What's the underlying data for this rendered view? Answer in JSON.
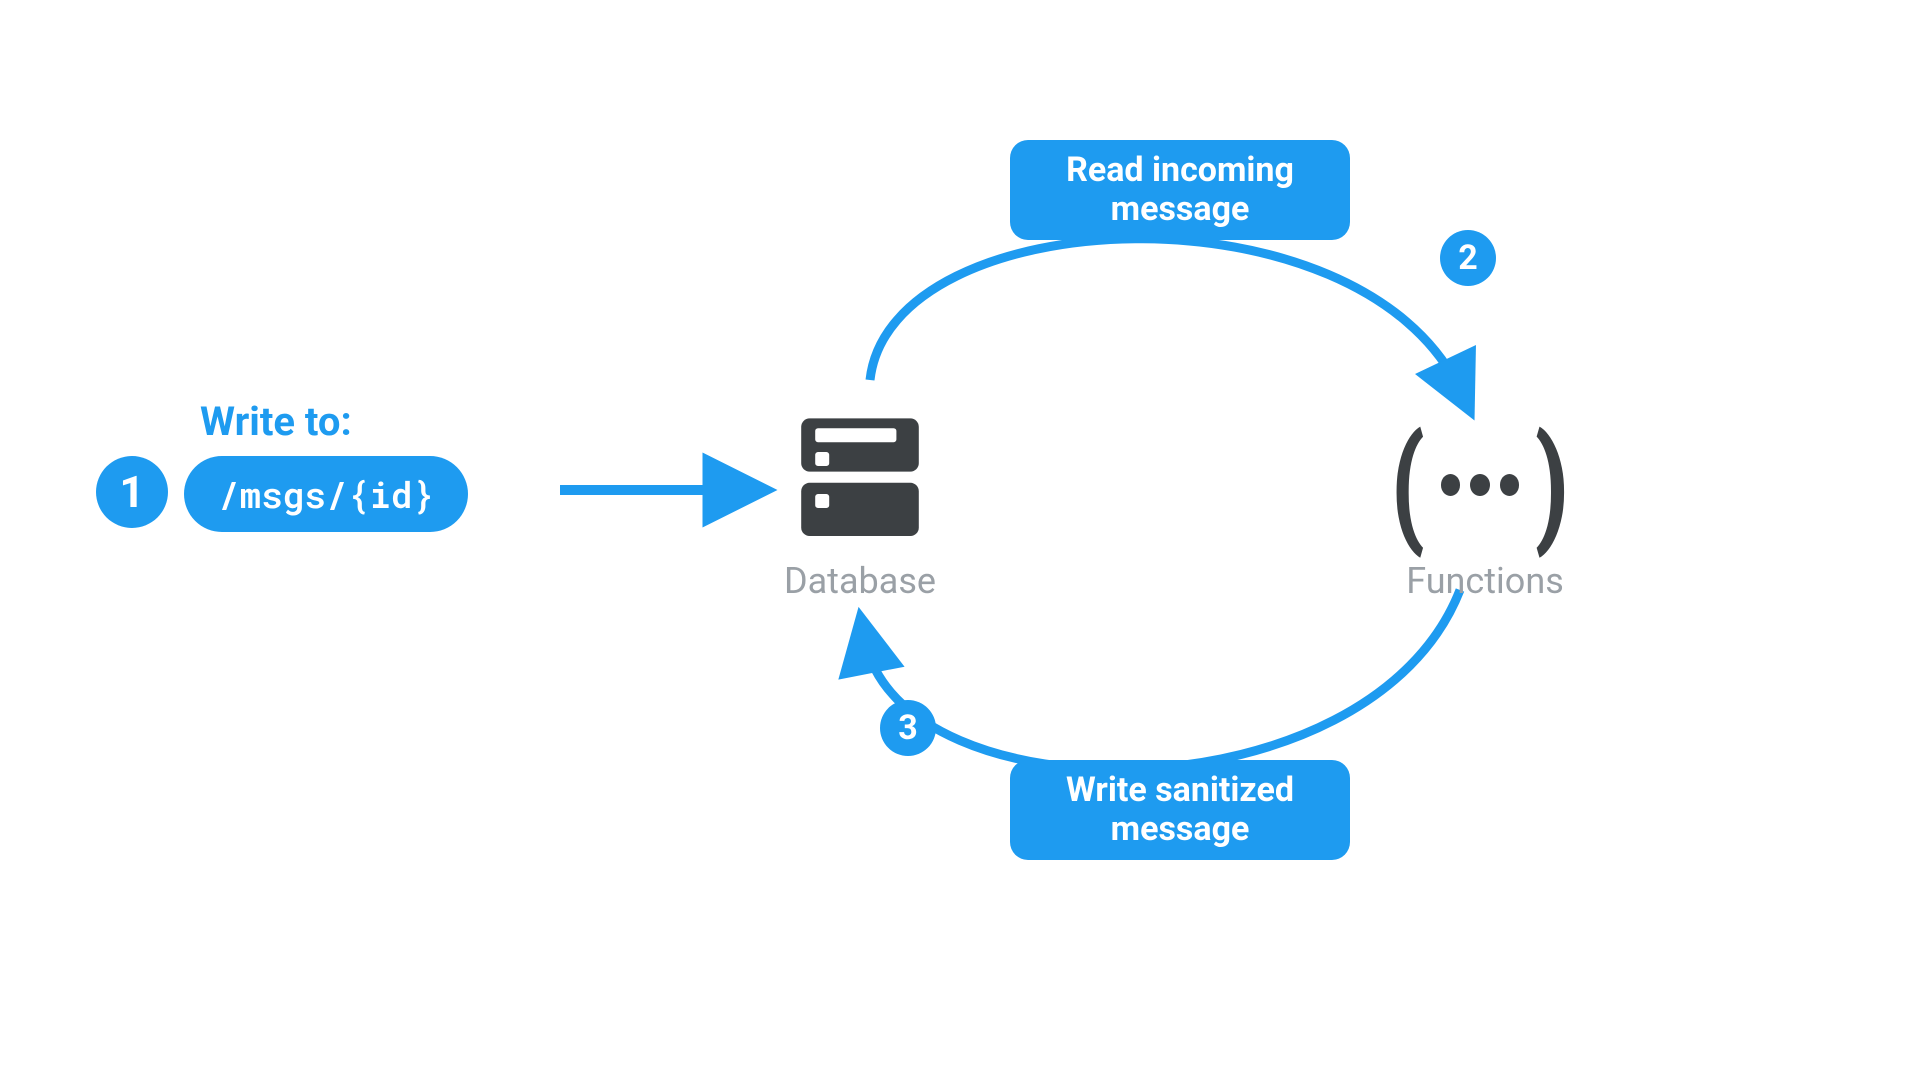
{
  "colors": {
    "blue": "#1e9bf0",
    "dark": "#3c4043",
    "muted": "#9aa0a6"
  },
  "writeTo": {
    "label": "Write to:",
    "path": "/msgs/{id}"
  },
  "steps": {
    "one": "1",
    "two": "2",
    "three": "3"
  },
  "flows": {
    "top": "Read incoming message",
    "bottom": "Write sanitized message"
  },
  "components": {
    "database": "Database",
    "functions": "Functions"
  }
}
